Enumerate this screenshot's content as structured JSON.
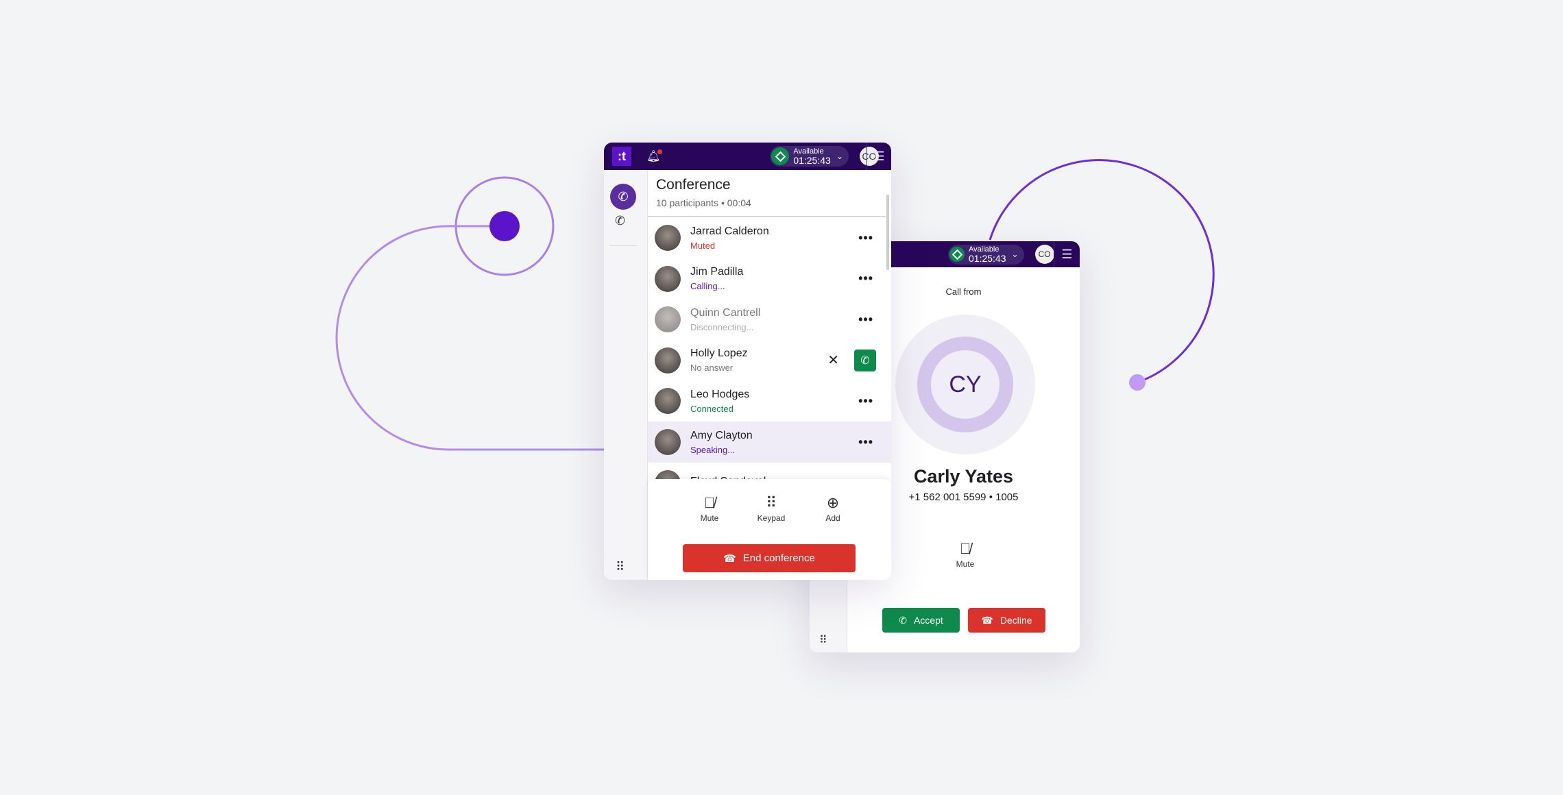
{
  "colors": {
    "brand": "#28065a",
    "accent": "#5b14c9",
    "green": "#0d8a4c",
    "red": "#d9332b"
  },
  "header": {
    "logo": ":t",
    "status_label": "Available",
    "status_time": "01:25:43",
    "user_initials": "CO"
  },
  "conference": {
    "title": "Conference",
    "subtitle": "10 participants • 00:04",
    "participants": [
      {
        "name": "Jarrad Calderon",
        "status": "Muted",
        "status_color": "#d9332b"
      },
      {
        "name": "Jim Padilla",
        "status": "Calling...",
        "status_color": "#5b14c9"
      },
      {
        "name": "Quinn Cantrell",
        "status": "Disconnecting...",
        "status_color": "#777"
      },
      {
        "name": "Holly Lopez",
        "status": "No answer",
        "status_color": "#777"
      },
      {
        "name": "Leo Hodges",
        "status": "Connected",
        "status_color": "#0d8a4c"
      },
      {
        "name": "Amy Clayton",
        "status": "Speaking...",
        "status_color": "#5b14c9"
      },
      {
        "name": "Floyd Sandoval",
        "status": "",
        "status_color": "#777"
      }
    ],
    "actions": {
      "mute": "Mute",
      "keypad": "Keypad",
      "add": "Add"
    },
    "end_label": "End conference"
  },
  "incoming": {
    "call_from": "Call from",
    "initials": "CY",
    "name": "Carly Yates",
    "phone": "+1 562 001 5599 • 1005",
    "mute": "Mute",
    "accept": "Accept",
    "decline": "Decline"
  }
}
